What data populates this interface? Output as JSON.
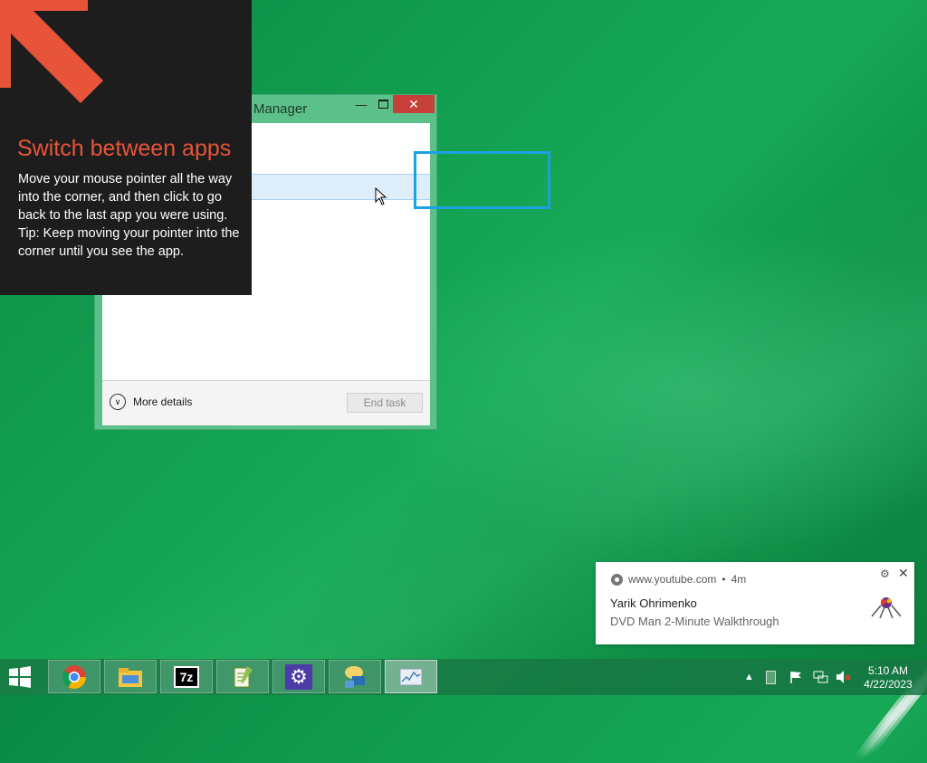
{
  "tip": {
    "title": "Switch between apps",
    "lines": [
      "Move your mouse pointer all the way into the corner, and then click to go back to the last app you were using.",
      "Tip: Keep moving your pointer into the corner until you see the app."
    ],
    "accent_color": "#e8543a"
  },
  "task_manager": {
    "title_partial": "Manager",
    "more_details_label": "More details",
    "end_task_label": "End task",
    "minimize_icon": "minimize-icon",
    "maximize_icon": "maximize-icon",
    "close_icon": "close-icon"
  },
  "notification": {
    "source": "www.youtube.com",
    "time": "4m",
    "title": "Yarik Ohrimenko",
    "body": "DVD Man 2-Minute Walkthrough"
  },
  "taskbar": {
    "apps": [
      "chrome-icon",
      "file-explorer-icon",
      "7zip-icon",
      "notepad-plus-plus-icon",
      "settings-gear-icon",
      "remote-desktop-icon",
      "task-manager-icon"
    ],
    "active_app": "task-manager-icon",
    "sevenzip_label": "7z",
    "clock_time": "5:10 AM",
    "clock_date": "4/22/2023"
  },
  "colors": {
    "highlight": "#1ba1e2",
    "close_button": "#c7403a"
  }
}
